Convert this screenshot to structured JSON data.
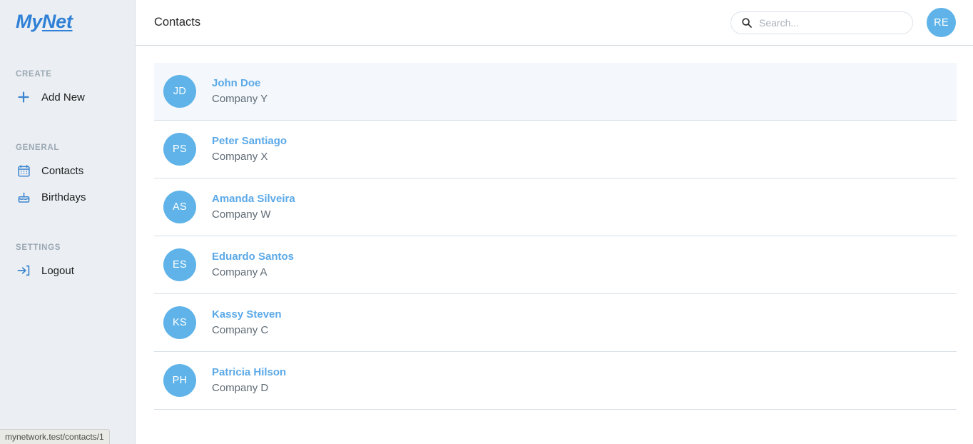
{
  "browser": {
    "status_url": "mynetwork.test/contacts/1"
  },
  "sidebar": {
    "logo": {
      "part1": "My",
      "part2": "Net"
    },
    "groups": [
      {
        "title": "CREATE",
        "items": [
          {
            "label": "Add New",
            "icon": "plus-icon"
          }
        ]
      },
      {
        "title": "GENERAL",
        "items": [
          {
            "label": "Contacts",
            "icon": "calendar-contacts-icon"
          },
          {
            "label": "Birthdays",
            "icon": "birthday-cake-icon"
          }
        ]
      },
      {
        "title": "SETTINGS",
        "items": [
          {
            "label": "Logout",
            "icon": "logout-icon"
          }
        ]
      }
    ]
  },
  "header": {
    "title": "Contacts",
    "search": {
      "placeholder": "Search...",
      "value": "",
      "icon": "search-icon"
    },
    "avatar": {
      "initials": "RE"
    }
  },
  "contacts": [
    {
      "initials": "JD",
      "name": "John Doe",
      "company": "Company Y",
      "selected": true
    },
    {
      "initials": "PS",
      "name": "Peter Santiago",
      "company": "Company X",
      "selected": false
    },
    {
      "initials": "AS",
      "name": "Amanda Silveira",
      "company": "Company W",
      "selected": false
    },
    {
      "initials": "ES",
      "name": "Eduardo Santos",
      "company": "Company A",
      "selected": false
    },
    {
      "initials": "KS",
      "name": "Kassy Steven",
      "company": "Company C",
      "selected": false
    },
    {
      "initials": "PH",
      "name": "Patricia Hilson",
      "company": "Company D",
      "selected": false
    }
  ],
  "colors": {
    "brand_blue": "#2f80d6",
    "avatar_blue": "#5fb3e8",
    "name_blue": "#5ba9e8",
    "sidebar_bg": "#ebeff3",
    "row_selected_bg": "#f4f8fc"
  }
}
